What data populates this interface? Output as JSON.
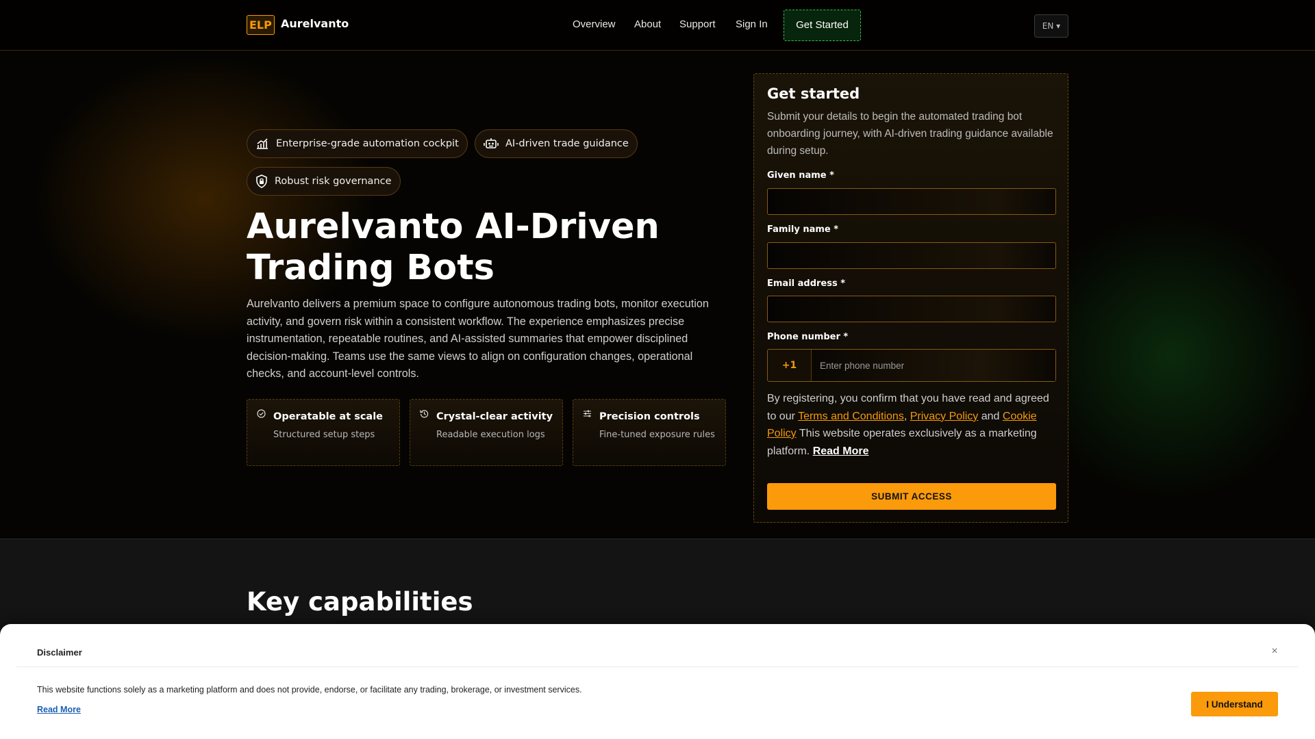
{
  "nav": {
    "logo": "ELP",
    "brand": "Aurelvanto",
    "links": [
      "Overview",
      "About",
      "Support",
      "Sign In"
    ],
    "cta": "Get Started",
    "language": "EN ▾"
  },
  "hero": {
    "pills": [
      {
        "label": "Enterprise-grade automation cockpit",
        "icon": "chart-growth-icon"
      },
      {
        "label": "AI-driven trade guidance",
        "icon": "robot-icon"
      },
      {
        "label": "Robust risk governance",
        "icon": "shield-icon"
      }
    ],
    "title_line1": "Aurelvanto AI-Driven",
    "title_line2": "Trading Bots",
    "description": "Aurelvanto delivers a premium space to configure autonomous trading bots, monitor execution activity, and govern risk within a consistent workflow. The experience emphasizes precise instrumentation, repeatable routines, and AI-assisted summaries that empower disciplined decision-making. Teams use the same views to align on configuration changes, operational checks, and account-level controls.",
    "features": [
      {
        "title": "Operatable at scale",
        "subtitle": "Structured setup steps",
        "icon": "check-circle-icon"
      },
      {
        "title": "Crystal-clear activity",
        "subtitle": "Readable execution logs",
        "icon": "history-icon"
      },
      {
        "title": "Precision controls",
        "subtitle": "Fine-tuned exposure rules",
        "icon": "sliders-icon"
      }
    ]
  },
  "form": {
    "title": "Get started",
    "description": "Submit your details to begin the automated trading bot onboarding journey, with AI-driven trading guidance available during setup.",
    "given_name_label": "Given name *",
    "family_name_label": "Family name *",
    "email_label": "Email address *",
    "phone_label": "Phone number *",
    "phone_prefix": "+1",
    "phone_placeholder": "Enter phone number",
    "consent_prefix": "By registering, you confirm that you have read and agreed to our ",
    "terms": "Terms and Conditions",
    "comma": ", ",
    "privacy": "Privacy Policy",
    "and": " and ",
    "cookie": "Cookie Policy",
    "consent_suffix": " This website operates exclusively as a marketing platform. ",
    "read_more": "Read More",
    "submit": "SUBMIT ACCESS"
  },
  "capabilities": {
    "title": "Key capabilities"
  },
  "disclaimer": {
    "title": "Disclaimer",
    "close": "×",
    "text": "This website functions solely as a marketing platform and does not provide, endorse, or facilitate any trading, brokerage, or investment services.",
    "read_more": "Read More",
    "button": "I Understand"
  },
  "colors": {
    "accent": "#fb9a0a",
    "cta_border": "#34c040",
    "background": "#000000"
  }
}
